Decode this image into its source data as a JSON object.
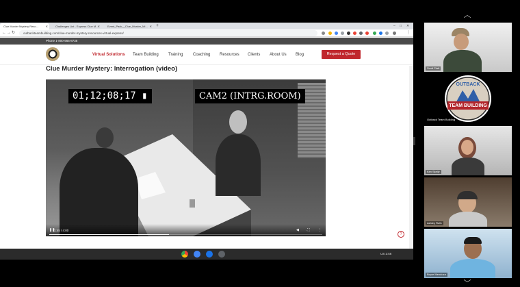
{
  "browser": {
    "tabs": [
      {
        "label": "Clue Murder Mystery Reso…",
        "active": true
      },
      {
        "label": "Challenges List - Express Clue M…",
        "active": false
      },
      {
        "label": "Event_Pack__Clue_Murder_Mi…",
        "active": false
      }
    ],
    "new_tab_label": "+",
    "url": "outbackteambuilding.com/clue-murder-mystery-resources-virtual-express/"
  },
  "site": {
    "phone": "Phone 1-800-565-8735",
    "nav": [
      "Virtual Solutions",
      "Team Building",
      "Training",
      "Coaching",
      "Resources",
      "Clients",
      "About Us",
      "Blog"
    ],
    "active_nav": "Virtual Solutions",
    "cta": "Request a Quote",
    "page_title": "Clue Murder Mystery: Interrogation (video)"
  },
  "video": {
    "timecode": "01;12;08;17",
    "camera_label": "CAM2 (INTRG.ROOM)",
    "time_display": "1:45 / 4:00",
    "progress_fraction": 0.4375
  },
  "taskbar": {
    "tray_text": "US  2:56",
    "colors": [
      "#ea4335",
      "#4285f4",
      "#1a73e8",
      "#5f6368"
    ]
  },
  "participants": [
    {
      "name": "Scott Platt",
      "logo": false
    },
    {
      "name": "Outback Team Building",
      "logo": true,
      "logo_top": "OUTBACK",
      "logo_bottom": "TEAM BUILDING"
    },
    {
      "name": "Kim Skelly",
      "logo": false
    },
    {
      "name": "Ashley Ruth",
      "logo": false
    },
    {
      "name": "Bryce Mendoza",
      "logo": false,
      "speaking": true
    }
  ],
  "colors": {
    "brand_red": "#c0272d",
    "speaker_highlight": "#c8e67a"
  }
}
